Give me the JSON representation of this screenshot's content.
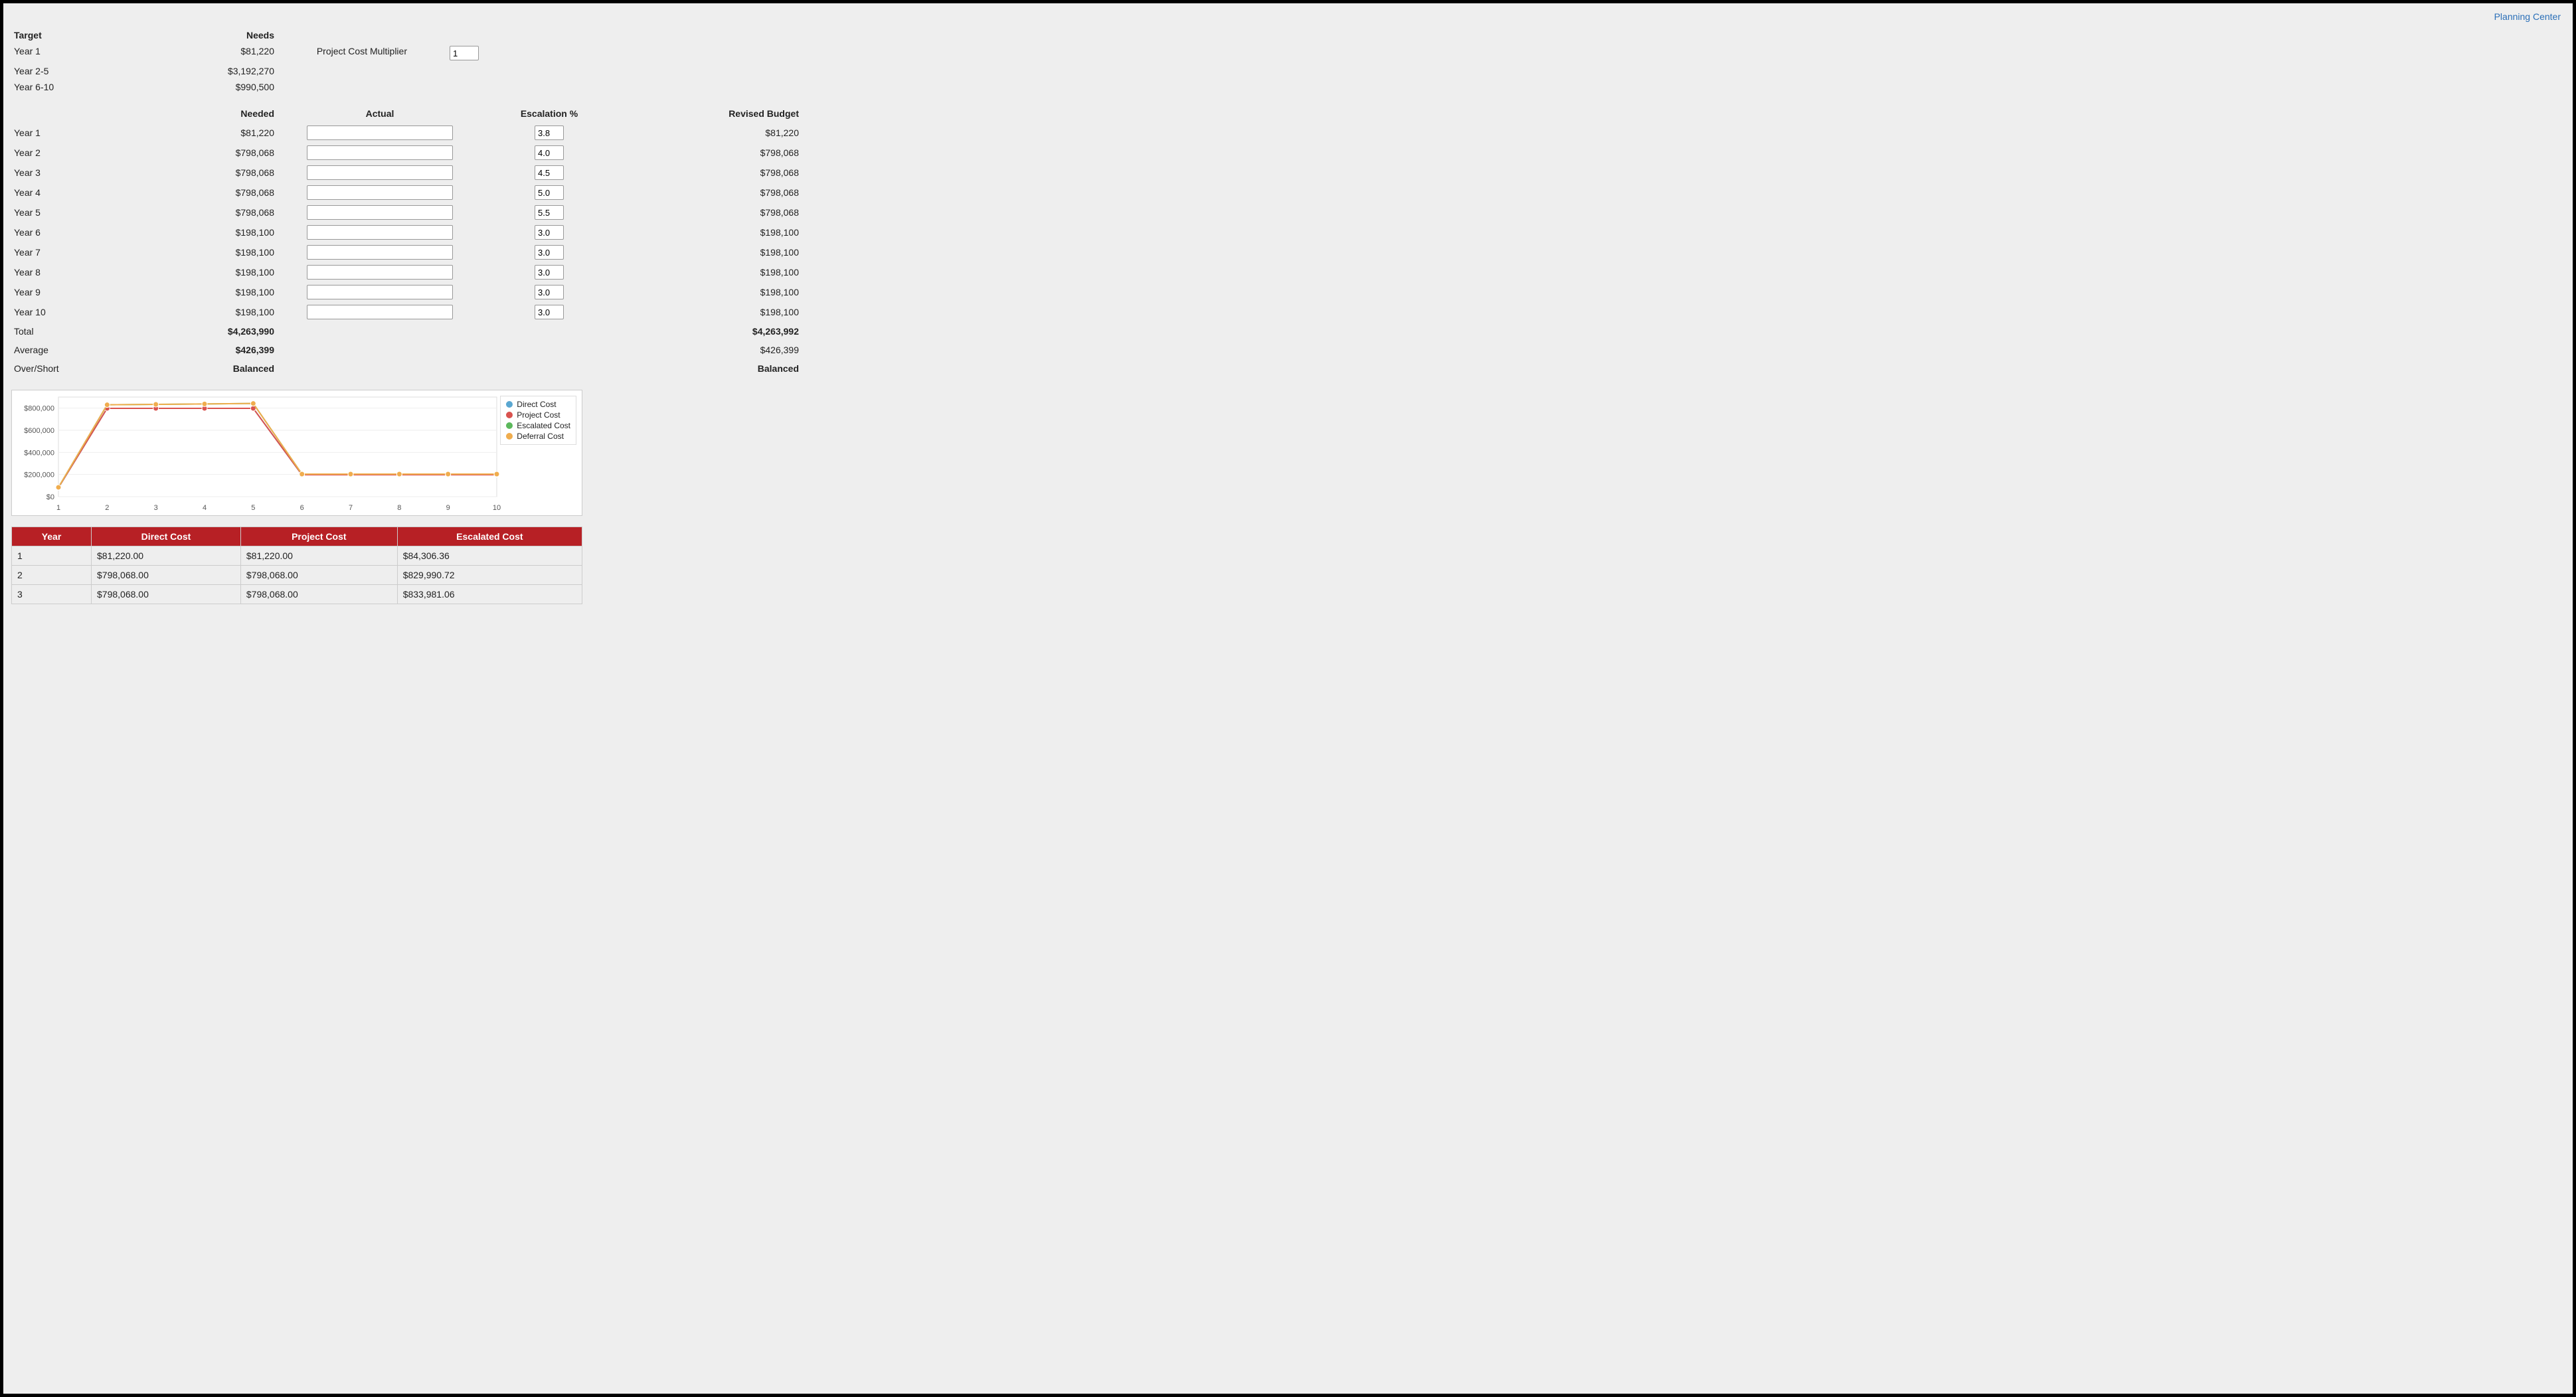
{
  "top_link": "Planning Center",
  "targets": {
    "header_target": "Target",
    "header_needs": "Needs",
    "rows": [
      {
        "label": "Year 1",
        "needs": "$81,220"
      },
      {
        "label": "Year 2-5",
        "needs": "$3,192,270"
      },
      {
        "label": "Year 6-10",
        "needs": "$990,500"
      }
    ]
  },
  "multiplier": {
    "label": "Project Cost Multiplier",
    "value": "1"
  },
  "columns": {
    "needed": "Needed",
    "actual": "Actual",
    "escalation": "Escalation %",
    "revised": "Revised Budget"
  },
  "rows": [
    {
      "label": "Year 1",
      "needed": "$81,220",
      "actual": "",
      "escalation": "3.8",
      "revised": "$81,220"
    },
    {
      "label": "Year 2",
      "needed": "$798,068",
      "actual": "",
      "escalation": "4.0",
      "revised": "$798,068"
    },
    {
      "label": "Year 3",
      "needed": "$798,068",
      "actual": "",
      "escalation": "4.5",
      "revised": "$798,068"
    },
    {
      "label": "Year 4",
      "needed": "$798,068",
      "actual": "",
      "escalation": "5.0",
      "revised": "$798,068"
    },
    {
      "label": "Year 5",
      "needed": "$798,068",
      "actual": "",
      "escalation": "5.5",
      "revised": "$798,068"
    },
    {
      "label": "Year 6",
      "needed": "$198,100",
      "actual": "",
      "escalation": "3.0",
      "revised": "$198,100"
    },
    {
      "label": "Year 7",
      "needed": "$198,100",
      "actual": "",
      "escalation": "3.0",
      "revised": "$198,100"
    },
    {
      "label": "Year 8",
      "needed": "$198,100",
      "actual": "",
      "escalation": "3.0",
      "revised": "$198,100"
    },
    {
      "label": "Year 9",
      "needed": "$198,100",
      "actual": "",
      "escalation": "3.0",
      "revised": "$198,100"
    },
    {
      "label": "Year 10",
      "needed": "$198,100",
      "actual": "",
      "escalation": "3.0",
      "revised": "$198,100"
    }
  ],
  "summary": {
    "total_label": "Total",
    "total_needed": "$4,263,990",
    "total_revised": "$4,263,992",
    "average_label": "Average",
    "average_needed": "$426,399",
    "average_revised": "$426,399",
    "overshort_label": "Over/Short",
    "overshort_needed": "Balanced",
    "overshort_revised": "Balanced"
  },
  "chart_data": {
    "type": "line",
    "x": [
      1,
      2,
      3,
      4,
      5,
      6,
      7,
      8,
      9,
      10
    ],
    "xlabel": "",
    "ylabel": "",
    "ylim": [
      0,
      900000
    ],
    "yticks": [
      0,
      200000,
      400000,
      600000,
      800000
    ],
    "ytick_labels": [
      "$0",
      "$200,000",
      "$400,000",
      "$600,000",
      "$800,000"
    ],
    "series": [
      {
        "name": "Direct Cost",
        "color": "#5aa7d1",
        "values": [
          81220,
          798068,
          798068,
          798068,
          798068,
          198100,
          198100,
          198100,
          198100,
          198100
        ]
      },
      {
        "name": "Project Cost",
        "color": "#d9534f",
        "values": [
          81220,
          798068,
          798068,
          798068,
          798068,
          198100,
          198100,
          198100,
          198100,
          198100
        ]
      },
      {
        "name": "Escalated Cost",
        "color": "#5cb85c",
        "values": [
          84306,
          829991,
          833981,
          837971,
          841960,
          204043,
          204043,
          204043,
          204043,
          204043
        ]
      },
      {
        "name": "Deferral Cost",
        "color": "#f0ad4e",
        "values": [
          84306,
          829991,
          833981,
          837971,
          841960,
          204043,
          204043,
          204043,
          204043,
          204043
        ]
      }
    ]
  },
  "cost_table": {
    "headers": [
      "Year",
      "Direct Cost",
      "Project Cost",
      "Escalated Cost"
    ],
    "rows": [
      {
        "year": "1",
        "direct": "$81,220.00",
        "project": "$81,220.00",
        "escalated": "$84,306.36"
      },
      {
        "year": "2",
        "direct": "$798,068.00",
        "project": "$798,068.00",
        "escalated": "$829,990.72"
      },
      {
        "year": "3",
        "direct": "$798,068.00",
        "project": "$798,068.00",
        "escalated": "$833,981.06"
      }
    ]
  }
}
